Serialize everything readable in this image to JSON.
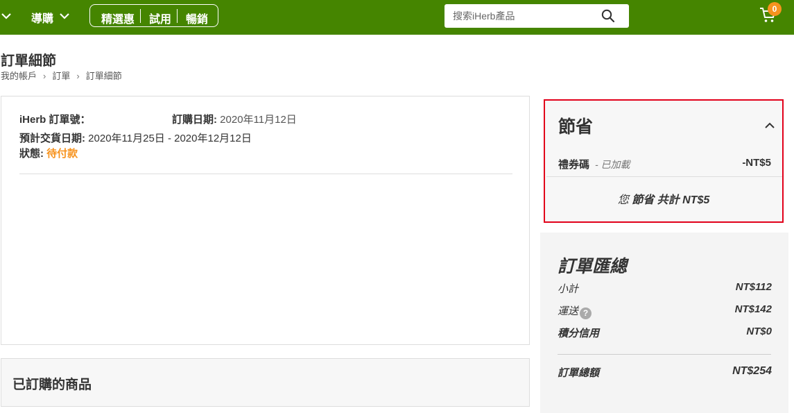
{
  "header": {
    "nav_label": "導購",
    "promo_links": [
      "精選惠",
      "試用",
      "暢銷"
    ],
    "search_placeholder": "搜索iHerb產品",
    "cart_count": "0",
    "brand_color": "#458500",
    "badge_color": "#f7931e"
  },
  "page": {
    "title": "訂單細節",
    "breadcrumb": [
      "我的帳戶",
      "訂單",
      "訂單細節"
    ]
  },
  "order": {
    "number_label": "iHerb 訂單號：",
    "number_value": "",
    "date_label": "訂購日期:",
    "date_value": "2020年11月12日",
    "delivery_label": "預計交貨日期:",
    "delivery_value": "2020年11月25日 - 2020年12月12日",
    "status_label": "狀態:",
    "status_value": "待付款",
    "status_color": "#f7931e"
  },
  "items": {
    "title": "已訂購的商品"
  },
  "savings": {
    "title": "節省",
    "coupon_label": "禮券碼",
    "coupon_status": " - 已加載",
    "coupon_value": "-NT$5",
    "total_prefix": "您",
    "total_text": "節省 共計 NT$5",
    "highlight_color": "#e2001a"
  },
  "summary": {
    "title": "訂單匯總",
    "rows": [
      {
        "label": "小計",
        "value": "NT$112"
      },
      {
        "label": "運送",
        "value": "NT$142"
      },
      {
        "label": "積分信用",
        "value": "NT$0"
      }
    ],
    "total_label": "訂單總額",
    "total_value": "NT$254"
  }
}
